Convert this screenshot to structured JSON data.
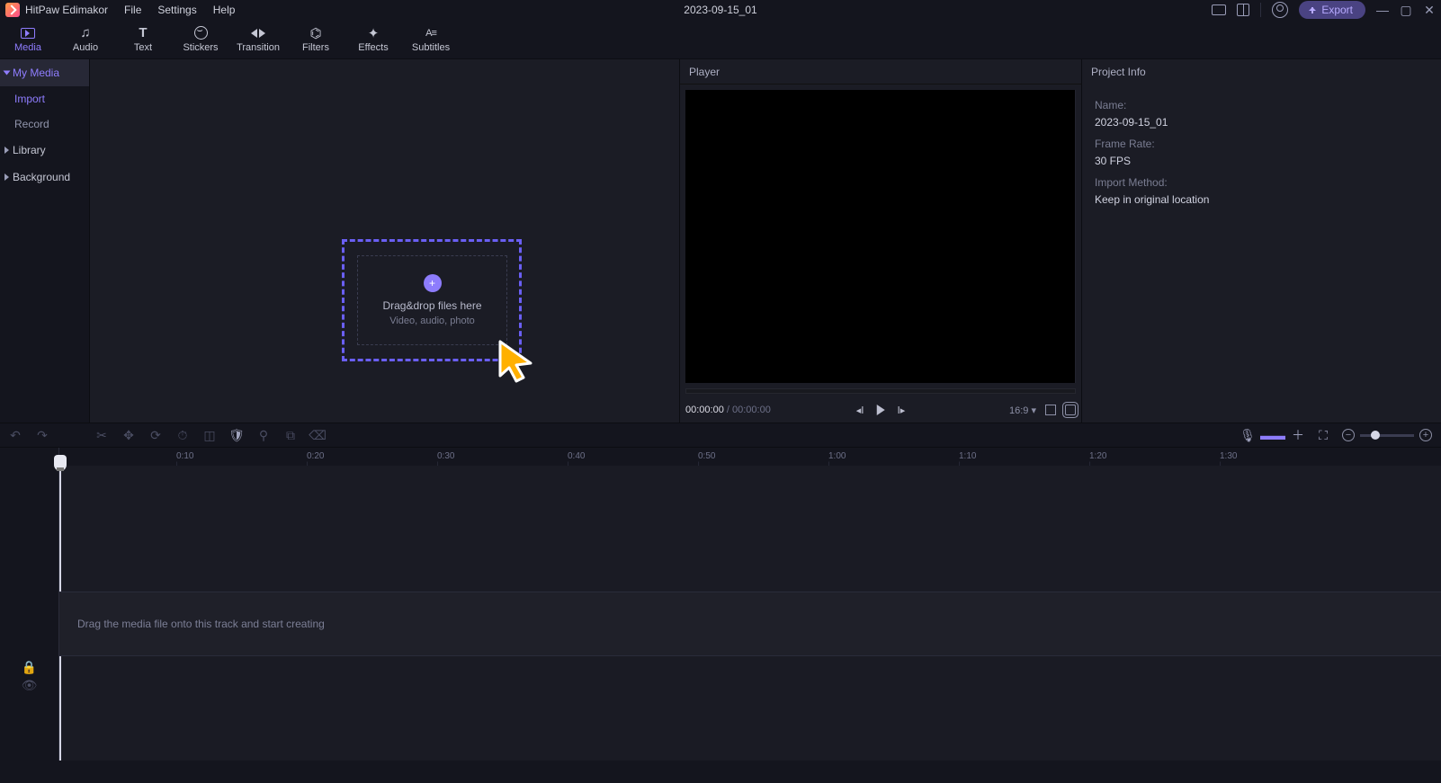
{
  "titlebar": {
    "app": "HitPaw Edimakor",
    "menus": [
      "File",
      "Settings",
      "Help"
    ],
    "center": "2023-09-15_01",
    "export": "Export"
  },
  "ribbon": [
    {
      "id": "media",
      "label": "Media",
      "active": true
    },
    {
      "id": "audio",
      "label": "Audio"
    },
    {
      "id": "text",
      "label": "Text"
    },
    {
      "id": "stickers",
      "label": "Stickers"
    },
    {
      "id": "transition",
      "label": "Transition"
    },
    {
      "id": "filters",
      "label": "Filters"
    },
    {
      "id": "effects",
      "label": "Effects"
    },
    {
      "id": "subtitles",
      "label": "Subtitles"
    }
  ],
  "sidebar": {
    "items": [
      {
        "label": "My Media",
        "caret": true,
        "sel": true
      },
      {
        "label": "Import",
        "sub": true,
        "active": true
      },
      {
        "label": "Record",
        "sub": true
      },
      {
        "label": "Library",
        "caret": true
      },
      {
        "label": "Background",
        "caret": true
      }
    ]
  },
  "dropzone": {
    "line1": "Drag&drop files here",
    "line2": "Video, audio, photo"
  },
  "player": {
    "title": "Player",
    "current": "00:00:00",
    "sep": " / ",
    "duration": "00:00:00",
    "ratio": "16:9 ▾"
  },
  "project": {
    "title": "Project Info",
    "name_label": "Name:",
    "name_value": "2023-09-15_01",
    "fr_label": "Frame Rate:",
    "fr_value": "30 FPS",
    "im_label": "Import Method:",
    "im_value": "Keep in original location"
  },
  "timeline": {
    "marks": [
      "0:10",
      "0:20",
      "0:30",
      "0:40",
      "0:50",
      "1:00",
      "1:10",
      "1:20",
      "1:30"
    ],
    "track_hint": "Drag the media file onto this track and start creating"
  }
}
